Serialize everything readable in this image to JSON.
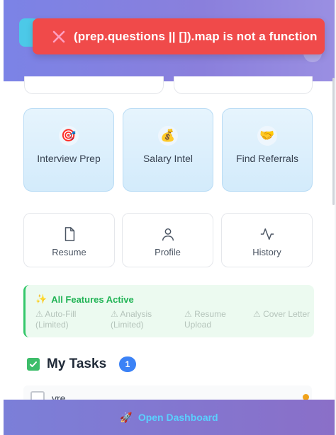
{
  "error_toast": {
    "message": "(prep.questions || []).map is not a function",
    "icon": "close-icon"
  },
  "feature_cards": [
    {
      "label": "Interview Prep",
      "icon": "target-icon",
      "emoji": "🎯"
    },
    {
      "label": "Salary Intel",
      "icon": "money-bag-icon",
      "emoji": "💰"
    },
    {
      "label": "Find Referrals",
      "icon": "handshake-icon",
      "emoji": "🤝"
    }
  ],
  "tools": [
    {
      "label": "Resume",
      "icon": "document-icon"
    },
    {
      "label": "Profile",
      "icon": "user-icon"
    },
    {
      "label": "History",
      "icon": "activity-icon"
    }
  ],
  "status": {
    "title": "All Features Active",
    "icon": "sparkle-icon",
    "items": [
      "⚠ Auto-Fill (Limited)",
      "⚠ Analysis (Limited)",
      "⚠ Resume Upload",
      "⚠ Cover Letter"
    ]
  },
  "tasks": {
    "title": "My Tasks",
    "count": "1",
    "items": [
      {
        "text": "vre",
        "checked": false,
        "priority_color": "#f0a21a"
      }
    ]
  },
  "footer": {
    "link_label": "Open Dashboard",
    "icon": "rocket-icon"
  },
  "colors": {
    "accent": "#7b83e6",
    "error": "#f04a4a",
    "success": "#22b456",
    "badge": "#3b82f6",
    "link": "#5ad0ff"
  }
}
